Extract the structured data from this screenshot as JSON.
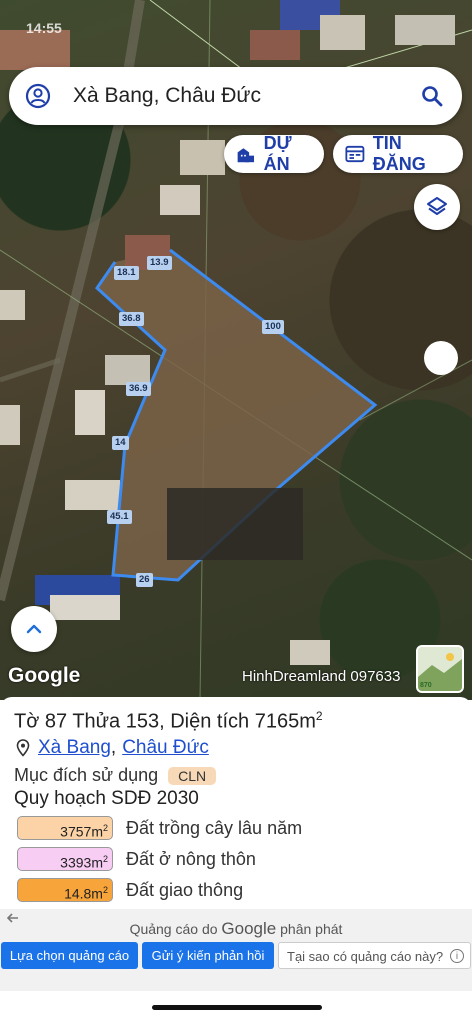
{
  "status": {
    "time": "14:55"
  },
  "search": {
    "query": "Xà Bang, Châu Đức"
  },
  "buttons": {
    "du_an": "DỰ ÁN",
    "tin_dang": "TIN ĐĂNG"
  },
  "map": {
    "google": "Google",
    "watermark": "HinhDreamland 097633",
    "thumb_label": "870",
    "segment_labels": [
      "18.1",
      "13.9",
      "100",
      "36.8",
      "36.9",
      "14",
      "45.1",
      "26"
    ],
    "boundary_color": "#3d8bf0"
  },
  "parcel": {
    "title": "Tờ 87 Thửa 153, Diện tích 7165m",
    "title_sup": "2",
    "commune": "Xà Bang",
    "district": "Châu Đức",
    "separator": ",",
    "purpose_label": "Mục đích sử dụng",
    "purpose_code": "CLN",
    "plan_title": "Quy hoạch SDĐ 2030",
    "zones": [
      {
        "area": "3757m",
        "sup": "2",
        "name": "Đất trồng cây lâu năm",
        "color": "#fbd3a6"
      },
      {
        "area": "3393m",
        "sup": "2",
        "name": "Đất ở nông thôn",
        "color": "#f7cdf3"
      },
      {
        "area": "14.8m",
        "sup": "2",
        "name": "Đất giao thông",
        "color": "#f7a43b"
      }
    ]
  },
  "ads": {
    "by_prefix": "Quảng cáo do",
    "by_brand": "Google",
    "by_suffix": "phân phát",
    "choice": "Lựa chọn quảng cáo",
    "feedback": "Gửi ý kiến phản hồi",
    "why": "Tại sao có quảng cáo này?",
    "info": "i"
  }
}
